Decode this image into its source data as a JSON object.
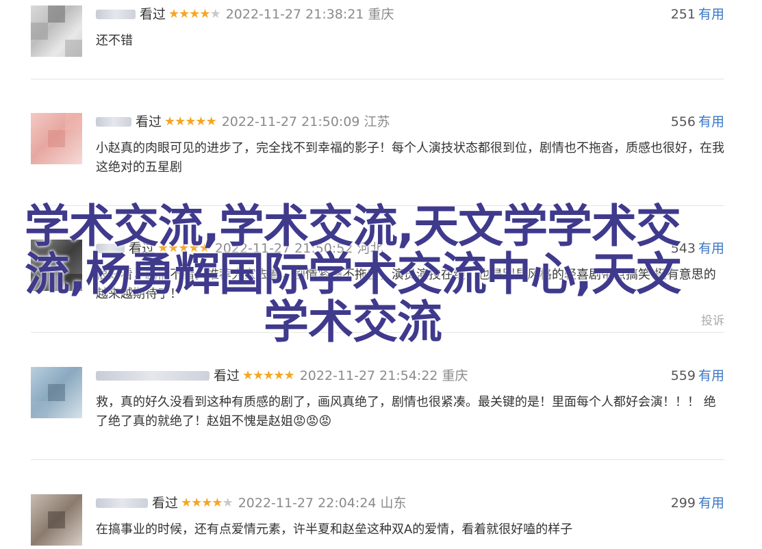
{
  "reviews": [
    {
      "watched": "看过",
      "rating": 4,
      "time": "2022-11-27 21:38:21",
      "location": "重庆",
      "useful_count": "251",
      "useful_label": "有用",
      "text": "还不错"
    },
    {
      "watched": "看过",
      "rating": 5,
      "time": "2022-11-27 21:50:09",
      "location": "江苏",
      "useful_count": "556",
      "useful_label": "有用",
      "text": "小赵真的肉眼可见的进步了，完全找不到幸福的影子！每个人演技状态都很到位，剧情也不拖沓，质感也很好，在我这绝对的五星剧"
    },
    {
      "watched": "看过",
      "rating": 5,
      "time": "2022-11-27 21:50:52",
      "location": "河北",
      "useful_count": "543",
      "useful_label": "有用",
      "text": "很好看，剧情不错，推荐大家去看，剧情紧凑不拖沓，演员演技在线，也是别具风格的轻喜剧带点搞笑 挺有意思的 越来越期待了！",
      "report": "投诉"
    },
    {
      "watched": "看过",
      "rating": 5,
      "time": "2022-11-27 21:54:22",
      "location": "重庆",
      "useful_count": "559",
      "useful_label": "有用",
      "text": "救，真的好久没看到这种有质感的剧了，画风真绝了，剧情也很紧凑。最关键的是！里面每个人都好会演！！！ 绝了绝了真的就绝了！赵姐不愧是赵姐😡😡😡"
    },
    {
      "watched": "看过",
      "rating": 4,
      "time": "2022-11-27 22:04:24",
      "location": "山东",
      "useful_count": "299",
      "useful_label": "有用",
      "text": "在搞事业的时候，还有点爱情元素，许半夏和赵垒这种双A的爱情，看着就很好嗑的样子"
    }
  ],
  "overlay_text": "学术交流,学术交流,天文学学术交流,杨勇辉国际学术交流中心,天文学术交流"
}
